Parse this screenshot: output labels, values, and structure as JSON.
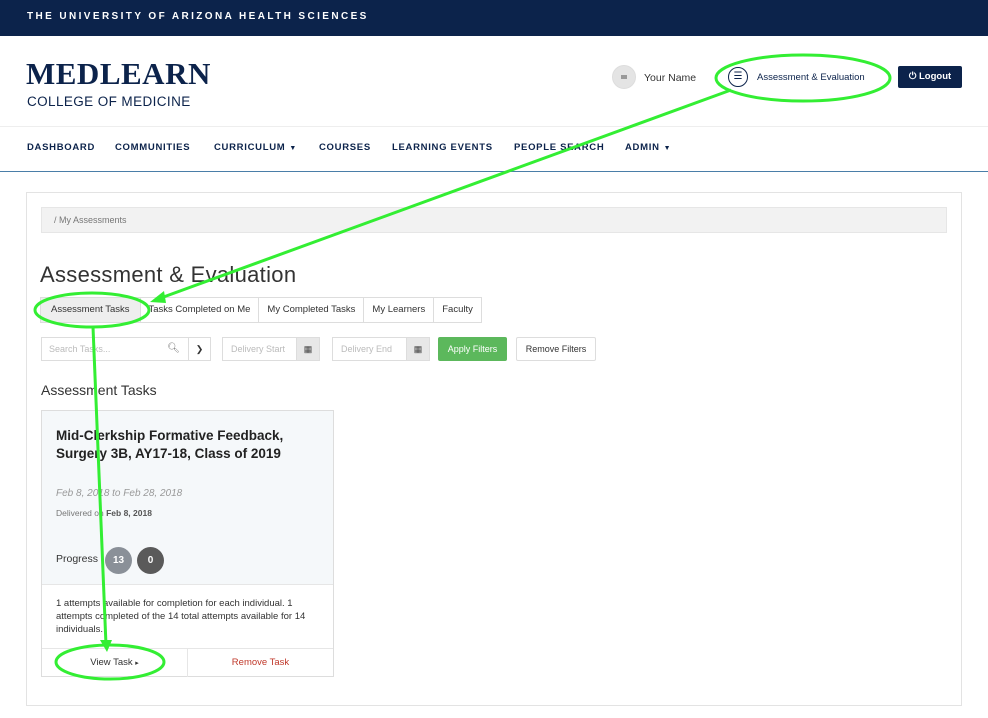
{
  "header": {
    "banner": "THE UNIVERSITY OF ARIZONA HEALTH SCIENCES",
    "logo_title": "MEDLEARN",
    "logo_subtitle": "COLLEGE OF MEDICINE",
    "user_name": "Your Name",
    "assessment_link": "Assessment & Evaluation",
    "logout_label": "Logout",
    "logout_icon": "power-icon"
  },
  "nav": {
    "items": [
      "DASHBOARD",
      "COMMUNITIES",
      "CURRICULUM",
      "COURSES",
      "LEARNING EVENTS",
      "PEOPLE SEARCH",
      "ADMIN"
    ]
  },
  "breadcrumb": "/  My Assessments",
  "page_title": "Assessment & Evaluation",
  "tabs": [
    "Assessment Tasks",
    "Tasks Completed on Me",
    "My Completed Tasks",
    "My Learners",
    "Faculty"
  ],
  "filters": {
    "search_placeholder": "Search Tasks...",
    "delivery_start_placeholder": "Delivery Start",
    "delivery_end_placeholder": "Delivery End",
    "apply_label": "Apply Filters",
    "remove_label": "Remove Filters"
  },
  "section_title": "Assessment Tasks",
  "task": {
    "title": "Mid-Clerkship Formative Feedback, Surgery 3B, AY17-18, Class of 2019",
    "dates": "Feb 8, 2018 to Feb 28, 2018",
    "delivered_prefix": "Delivered on",
    "delivered_date": "Feb 8, 2018",
    "progress_label": "Progress",
    "progress_a": "13",
    "progress_b": "0",
    "description": "1 attempts available for completion for each individual. 1 attempts completed of the 14 total attempts available for 14 individuals.",
    "view_label": "View Task",
    "remove_label": "Remove Task"
  },
  "colors": {
    "brand_navy": "#0c234b",
    "apply_green": "#5cb85c",
    "highlight_green": "#33ee33",
    "remove_red": "#c0392b"
  }
}
